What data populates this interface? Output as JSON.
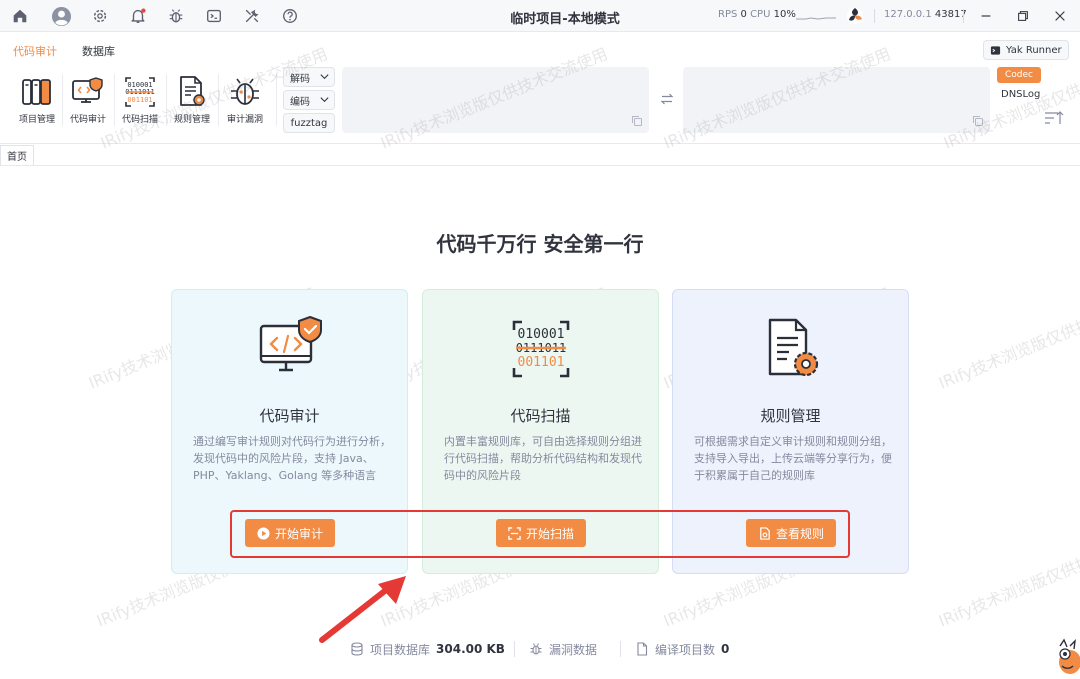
{
  "titlebar": {
    "title": "临时项目-本地模式",
    "rps_label": "RPS",
    "rps_value": "0",
    "cpu_label": "CPU",
    "cpu_value": "10%",
    "ip": "127.0.0.1",
    "port": "43817",
    "icons": [
      "home-icon",
      "user-avatar-icon",
      "settings-gear-icon",
      "notification-bell-icon",
      "bug-icon",
      "terminal-icon",
      "tools-icon",
      "help-icon"
    ],
    "notification_dot_color": "#f04438"
  },
  "ribbon": {
    "tabs": [
      {
        "label": "代码审计",
        "active": true
      },
      {
        "label": "数据库",
        "active": false
      }
    ],
    "tools": [
      {
        "label": "项目管理",
        "icon": "project-management-icon"
      },
      {
        "label": "代码审计",
        "icon": "code-audit-icon"
      },
      {
        "label": "代码扫描",
        "icon": "code-scan-icon"
      },
      {
        "label": "规则管理",
        "icon": "rule-management-icon"
      },
      {
        "label": "审计漏洞",
        "icon": "audit-vuln-icon"
      }
    ],
    "decode_label": "解码",
    "encode_label": "编码",
    "fuzztag_label": "fuzztag",
    "yak_runner_label": "Yak Runner",
    "codec_label": "Codec",
    "dnslog_label": "DNSLog"
  },
  "page_tab": {
    "label": "首页"
  },
  "main": {
    "hero": "代码千万行 安全第一行",
    "cards": [
      {
        "title": "代码审计",
        "desc": "通过编写审计规则对代码行为进行分析，发现代码中的风险片段，支持 Java、PHP、Yaklang、Golang 等多种语言",
        "button": "开始审计"
      },
      {
        "title": "代码扫描",
        "desc": "内置丰富规则库，可自由选择规则分组进行代码扫描，帮助分析代码结构和发现代码中的风险片段",
        "button": "开始扫描"
      },
      {
        "title": "规则管理",
        "desc": "可根据需求自定义审计规则和规则分组，支持导入导出，上传云端等分享行为，便于积累属于自己的规则库",
        "button": "查看规则"
      }
    ],
    "scan_icon_text": [
      "010001",
      "0111011",
      "001101"
    ]
  },
  "footer": {
    "db_label": "项目数据库",
    "db_value": "304.00 KB",
    "vuln_label": "漏洞数据",
    "compile_label": "编译项目数",
    "compile_value": "0"
  },
  "watermark": "IRify技术浏览版仅供技术交流使用",
  "colors": {
    "accent": "#f28b44",
    "highlight_red": "#e53935",
    "text_primary": "#31343f",
    "text_secondary": "#85899e"
  }
}
